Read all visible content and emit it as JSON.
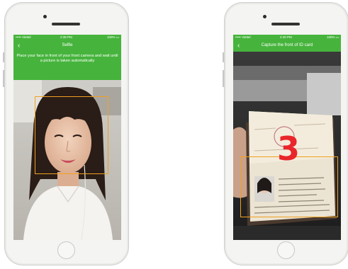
{
  "colors": {
    "accent": "#46b43c",
    "frame": "#f0a020",
    "countdown": "#e8262b"
  },
  "left_screen": {
    "status": {
      "carrier": "••••• Viettel",
      "time": "2:38 PM",
      "battery": "100% ▭"
    },
    "nav": {
      "back_icon": "chevron-left-icon",
      "title": "Selfie"
    },
    "instruction": "Place your face in front of your front camera and wait until a picture is taken automatically"
  },
  "right_screen": {
    "status": {
      "carrier": "••••• Viettel",
      "time": "2:40 PM",
      "battery": "100% ▭"
    },
    "nav": {
      "back_icon": "chevron-left-icon",
      "title": "Capture the front of ID card"
    },
    "countdown": "3"
  }
}
